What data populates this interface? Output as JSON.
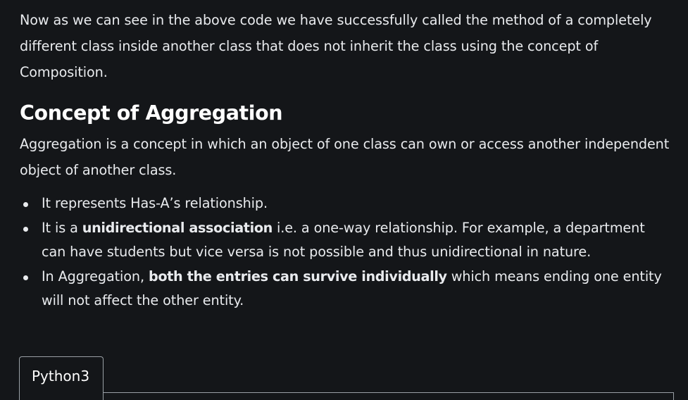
{
  "intro": {
    "text": "Now as we can see in the above code we have successfully called the method of a completely different class inside another class that does not inherit the class using the concept of Composition."
  },
  "section": {
    "heading": "Concept of Aggregation",
    "paragraph": "Aggregation is a concept in which an object of one class can own or access another independent object of another class."
  },
  "bullets": [
    {
      "before": "It represents Has-A’s relationship.",
      "bold": "",
      "after": ""
    },
    {
      "before": "It is a ",
      "bold": "unidirectional association",
      "after": " i.e. a one-way relationship. For example, a department can have students but vice versa is not possible and thus unidirectional in nature."
    },
    {
      "before": "In Aggregation, ",
      "bold": "both the entries can survive individually",
      "after": " which means ending one entity will not affect the other entity."
    }
  ],
  "code_tabs": {
    "active_tab": "Python3"
  },
  "colors": {
    "background": "#141619",
    "text": "#e9ebee",
    "tab_border": "#9aa0a6"
  }
}
